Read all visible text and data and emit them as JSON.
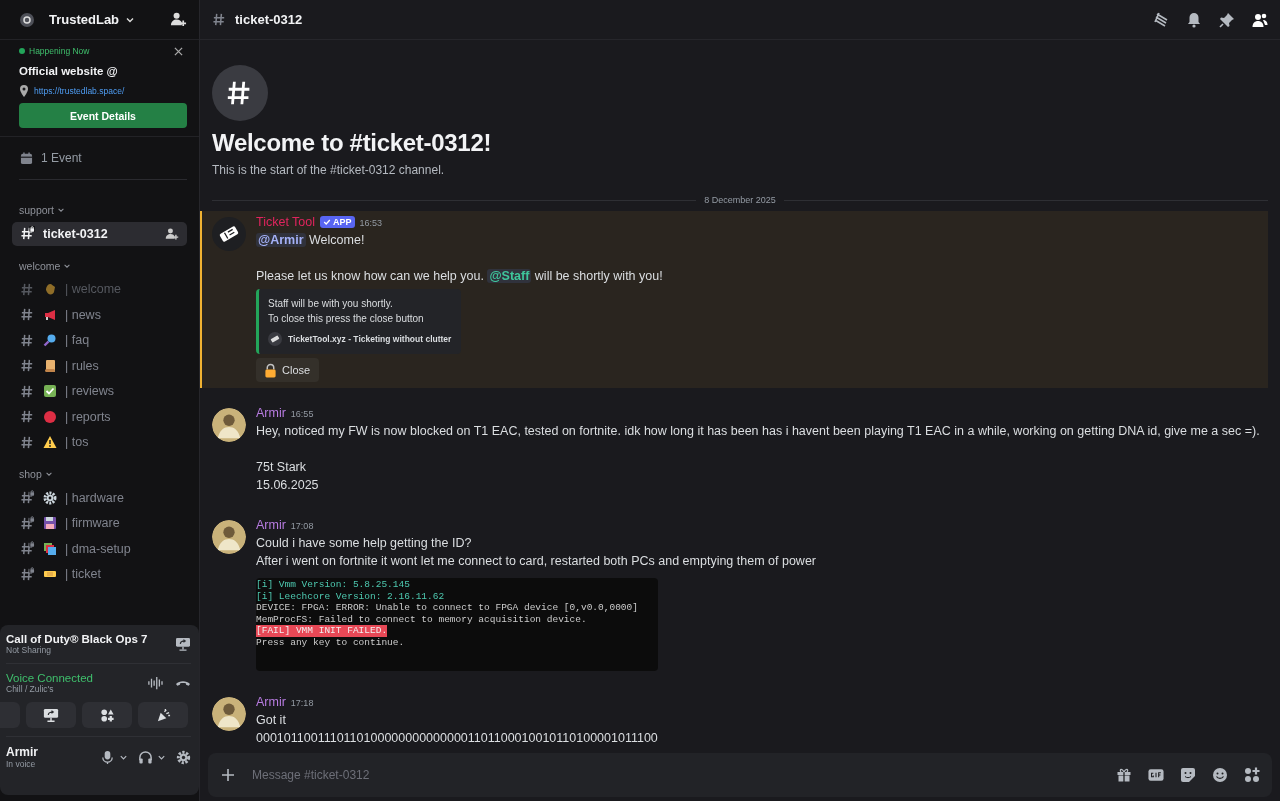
{
  "server": {
    "name": "TrustedLab"
  },
  "event_card": {
    "status": "Happening Now",
    "title": "Official website @",
    "link": "https://trustedlab.space/",
    "button": "Event Details"
  },
  "events_row": {
    "label": "1 Event"
  },
  "categories": [
    {
      "name": "support",
      "channels": [
        {
          "name": "ticket-0312",
          "selected": true,
          "muted": false,
          "locked": true
        }
      ]
    },
    {
      "name": "welcome",
      "channels": [
        {
          "name": "| welcome",
          "selected": false,
          "muted": true,
          "locked": false
        },
        {
          "name": "| news",
          "selected": false,
          "muted": false,
          "locked": false
        },
        {
          "name": "| faq",
          "selected": false,
          "muted": false,
          "locked": false
        },
        {
          "name": "| rules",
          "selected": false,
          "muted": false,
          "locked": false
        },
        {
          "name": "| reviews",
          "selected": false,
          "muted": false,
          "locked": false
        },
        {
          "name": "| reports",
          "selected": false,
          "muted": false,
          "locked": false
        },
        {
          "name": "| tos",
          "selected": false,
          "muted": false,
          "locked": false
        }
      ]
    },
    {
      "name": "shop",
      "channels": [
        {
          "name": "| hardware",
          "selected": false,
          "muted": false,
          "locked": true
        },
        {
          "name": "| firmware",
          "selected": false,
          "muted": false,
          "locked": true
        },
        {
          "name": "| dma-setup",
          "selected": false,
          "muted": false,
          "locked": true
        },
        {
          "name": "| ticket",
          "selected": false,
          "muted": false,
          "locked": true
        }
      ]
    }
  ],
  "activity": {
    "title": "Call of Duty® Black Ops 7",
    "subtitle": "Not Sharing"
  },
  "voice": {
    "status": "Voice Connected",
    "channel": "Chill / Zulic's"
  },
  "user": {
    "name": "Armir",
    "status": "In voice"
  },
  "header": {
    "channel": "ticket-0312"
  },
  "welcome": {
    "title": "Welcome to #ticket-0312!",
    "subtitle": "This is the start of the #ticket-0312 channel."
  },
  "date_divider": "8 December 2025",
  "messages": [
    {
      "kind": "bot",
      "author": "Ticket Tool",
      "color": "#e0245e",
      "badge": "APP",
      "time": "16:53",
      "highlighted": true,
      "blocks": [
        [
          [
            {
              "text": "@Armir",
              "kind": "mention",
              "color": "#a4b1f7"
            },
            {
              "text": " Welcome!",
              "kind": "plain"
            }
          ]
        ],
        [
          [
            {
              "text": "Please let us know how can we help you. ",
              "kind": "plain"
            },
            {
              "text": "@Staff",
              "kind": "mention",
              "color": "#3fc59b"
            },
            {
              "text": " will be shortly with you!",
              "kind": "plain"
            }
          ]
        ]
      ],
      "embed": {
        "color": "#23a55a",
        "lines": [
          "Staff will be with you shortly.",
          "To close this press the close button"
        ],
        "footer": "TicketTool.xyz - Ticketing without clutter"
      },
      "button": "Close"
    },
    {
      "kind": "user",
      "author": "Armir",
      "color": "#b77be0",
      "time": "16:55",
      "highlighted": false,
      "blocks": [
        [
          [
            {
              "text": "Hey, noticed my FW is now blocked on T1 EAC, tested on fortnite. idk how long it has been has i havent been playing T1 EAC in a while, working on getting DNA id, give me a sec =).",
              "kind": "plain"
            }
          ]
        ],
        [
          [
            {
              "text": "75t Stark",
              "kind": "plain"
            }
          ],
          [
            {
              "text": "15.06.2025",
              "kind": "plain"
            }
          ]
        ]
      ]
    },
    {
      "kind": "user",
      "author": "Armir",
      "color": "#b77be0",
      "time": "17:08",
      "highlighted": false,
      "blocks": [
        [
          [
            {
              "text": "Could i have some help getting the ID?",
              "kind": "plain"
            }
          ],
          [
            {
              "text": "After i went on fortnite it wont let me connect to card, restarted both PCs and emptying them of power",
              "kind": "plain"
            }
          ]
        ]
      ],
      "console": [
        {
          "text": "[i] Vmm Version: 5.8.25.145",
          "kind": "info"
        },
        {
          "text": "[i] Leechcore Version: 2.16.11.62",
          "kind": "info"
        },
        {
          "text": "DEVICE: FPGA: ERROR: Unable to connect to FPGA device [0,v0.0,0000]",
          "kind": "plain"
        },
        {
          "text": "MemProcFS: Failed to connect to memory acquisition device.",
          "kind": "plain"
        },
        {
          "text": "[FAIL] VMM INIT FAILED.",
          "kind": "fail"
        },
        {
          "text": "Press any key to continue.",
          "kind": "plain"
        }
      ]
    },
    {
      "kind": "user",
      "author": "Armir",
      "color": "#b77be0",
      "time": "17:18",
      "highlighted": false,
      "blocks": [
        [
          [
            {
              "text": "Got it",
              "kind": "plain"
            }
          ],
          [
            {
              "text": "00010110011101101000000000000001101100010010110100001011100",
              "kind": "plain"
            }
          ]
        ]
      ]
    }
  ],
  "composer": {
    "placeholder": "Message #ticket-0312"
  }
}
